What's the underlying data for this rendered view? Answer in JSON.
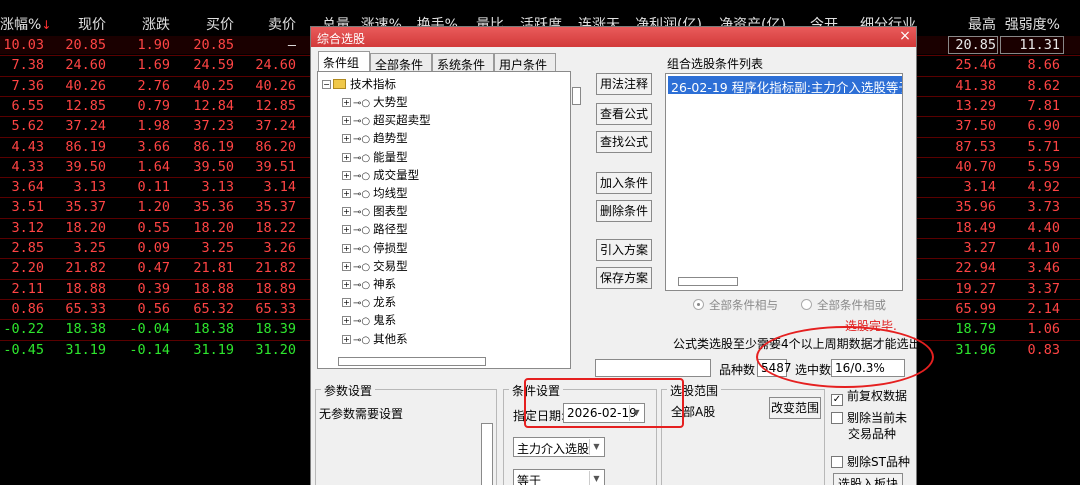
{
  "grid": {
    "headers": {
      "chg_pct": "涨幅%",
      "sort_arrow": "↓",
      "price": "现价",
      "change": "涨跌",
      "bid": "买价",
      "ask": "卖价",
      "volume": "总量",
      "speed": "涨速%",
      "turnover": "换手%",
      "vol_ratio": "量比",
      "activity": "活跃度",
      "streak": "连涨天",
      "net_profit": "净利润(亿)",
      "net_assets": "净资产(亿)",
      "open": "今开",
      "industry": "细分行业",
      "high": "最高",
      "strength": "强弱度%"
    },
    "rows": [
      {
        "chg": "10.03",
        "price": "20.85",
        "d": "1.90",
        "bid": "20.85",
        "ask": "–",
        "high": "20.85",
        "str": "11.31",
        "dir": "up"
      },
      {
        "chg": "7.38",
        "price": "24.60",
        "d": "1.69",
        "bid": "24.59",
        "ask": "24.60",
        "high": "25.46",
        "str": "8.66",
        "dir": "up"
      },
      {
        "chg": "7.36",
        "price": "40.26",
        "d": "2.76",
        "bid": "40.25",
        "ask": "40.26",
        "high": "41.38",
        "str": "8.62",
        "dir": "up"
      },
      {
        "chg": "6.55",
        "price": "12.85",
        "d": "0.79",
        "bid": "12.84",
        "ask": "12.85",
        "high": "13.29",
        "str": "7.81",
        "dir": "up"
      },
      {
        "chg": "5.62",
        "price": "37.24",
        "d": "1.98",
        "bid": "37.23",
        "ask": "37.24",
        "high": "37.50",
        "str": "6.90",
        "dir": "up"
      },
      {
        "chg": "4.43",
        "price": "86.19",
        "d": "3.66",
        "bid": "86.19",
        "ask": "86.20",
        "high": "87.53",
        "str": "5.71",
        "dir": "up"
      },
      {
        "chg": "4.33",
        "price": "39.50",
        "d": "1.64",
        "bid": "39.50",
        "ask": "39.51",
        "high": "40.70",
        "str": "5.59",
        "dir": "up"
      },
      {
        "chg": "3.64",
        "price": "3.13",
        "d": "0.11",
        "bid": "3.13",
        "ask": "3.14",
        "high": "3.14",
        "str": "4.92",
        "dir": "up"
      },
      {
        "chg": "3.51",
        "price": "35.37",
        "d": "1.20",
        "bid": "35.36",
        "ask": "35.37",
        "high": "35.96",
        "str": "3.73",
        "dir": "up"
      },
      {
        "chg": "3.12",
        "price": "18.20",
        "d": "0.55",
        "bid": "18.20",
        "ask": "18.22",
        "high": "18.49",
        "str": "4.40",
        "dir": "up"
      },
      {
        "chg": "2.85",
        "price": "3.25",
        "d": "0.09",
        "bid": "3.25",
        "ask": "3.26",
        "high": "3.27",
        "str": "4.10",
        "dir": "up"
      },
      {
        "chg": "2.20",
        "price": "21.82",
        "d": "0.47",
        "bid": "21.81",
        "ask": "21.82",
        "high": "22.94",
        "str": "3.46",
        "dir": "up"
      },
      {
        "chg": "2.11",
        "price": "18.88",
        "d": "0.39",
        "bid": "18.88",
        "ask": "18.89",
        "high": "19.27",
        "str": "3.37",
        "dir": "up"
      },
      {
        "chg": "0.86",
        "price": "65.33",
        "d": "0.56",
        "bid": "65.32",
        "ask": "65.33",
        "high": "65.99",
        "str": "2.14",
        "dir": "up"
      },
      {
        "chg": "-0.22",
        "price": "18.38",
        "d": "-0.04",
        "bid": "18.38",
        "ask": "18.39",
        "high": "18.79",
        "str": "1.06",
        "dir": "down"
      },
      {
        "chg": "-0.45",
        "price": "31.19",
        "d": "-0.14",
        "bid": "31.19",
        "ask": "31.20",
        "high": "31.96",
        "str": "0.83",
        "dir": "down"
      }
    ]
  },
  "dialog": {
    "title": "综合选股",
    "close": "×",
    "tabs": [
      "条件组",
      "全部条件",
      "系统条件",
      "用户条件"
    ],
    "tree": {
      "root": "技术指标",
      "items": [
        "大势型",
        "超买超卖型",
        "趋势型",
        "能量型",
        "成交量型",
        "均线型",
        "图表型",
        "路径型",
        "停损型",
        "交易型",
        "神系",
        "龙系",
        "鬼系",
        "其他系"
      ]
    },
    "buttons": {
      "usage": "用法注释",
      "view_formula": "查看公式",
      "find_formula": "查找公式",
      "add_condition": "加入条件",
      "delete_condition": "删除条件",
      "import_plan": "引入方案",
      "save_plan": "保存方案",
      "change_range": "改变范围",
      "select_to_block": "选股入板块"
    },
    "list": {
      "label": "组合选股条件列表",
      "selected": "26-02-19 程序化指标副:主力介入选股等于"
    },
    "radios": {
      "all_and": "全部条件相与",
      "all_or": "全部条件相或"
    },
    "done": "选股完毕.",
    "notice": "公式类选股至少需要4个以上周期数据才能选出",
    "stats": {
      "count_label": "品种数",
      "count": "5487",
      "selected_label": "选中数",
      "selected": "16/0.3%"
    },
    "params": {
      "title": "参数设置",
      "text": "无参数需要设置"
    },
    "cond": {
      "title": "条件设置",
      "date_label": "指定日期:",
      "date": "2026-02-19",
      "formula": "主力介入选股",
      "op": "等于"
    },
    "range": {
      "title": "选股范围",
      "value": "全部A股"
    },
    "checks": {
      "restore_rights": "前复权数据",
      "restore_rights_checked": "✓",
      "exclude_untradable_1": "剔除当前未",
      "exclude_untradable_2": "交易品种",
      "exclude_st": "剔除ST品种"
    }
  }
}
